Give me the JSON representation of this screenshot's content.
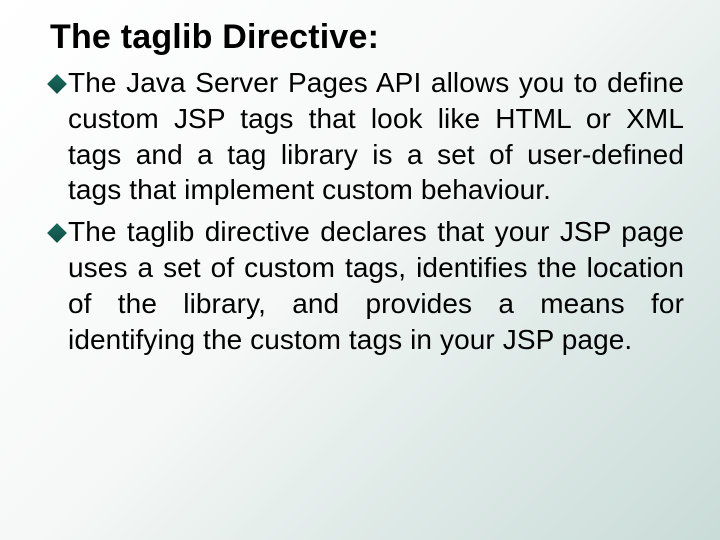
{
  "slide": {
    "title": "The taglib Directive:",
    "items": [
      {
        "text": "The Java Server Pages API allows you to define custom JSP tags that look like HTML or XML tags and a tag library is a set of user-defined tags that implement custom behaviour."
      },
      {
        "text": "The taglib directive declares that your JSP page uses a set of custom tags, identifies the location of the library, and provides a means for identifying the custom tags in your JSP page."
      }
    ]
  }
}
